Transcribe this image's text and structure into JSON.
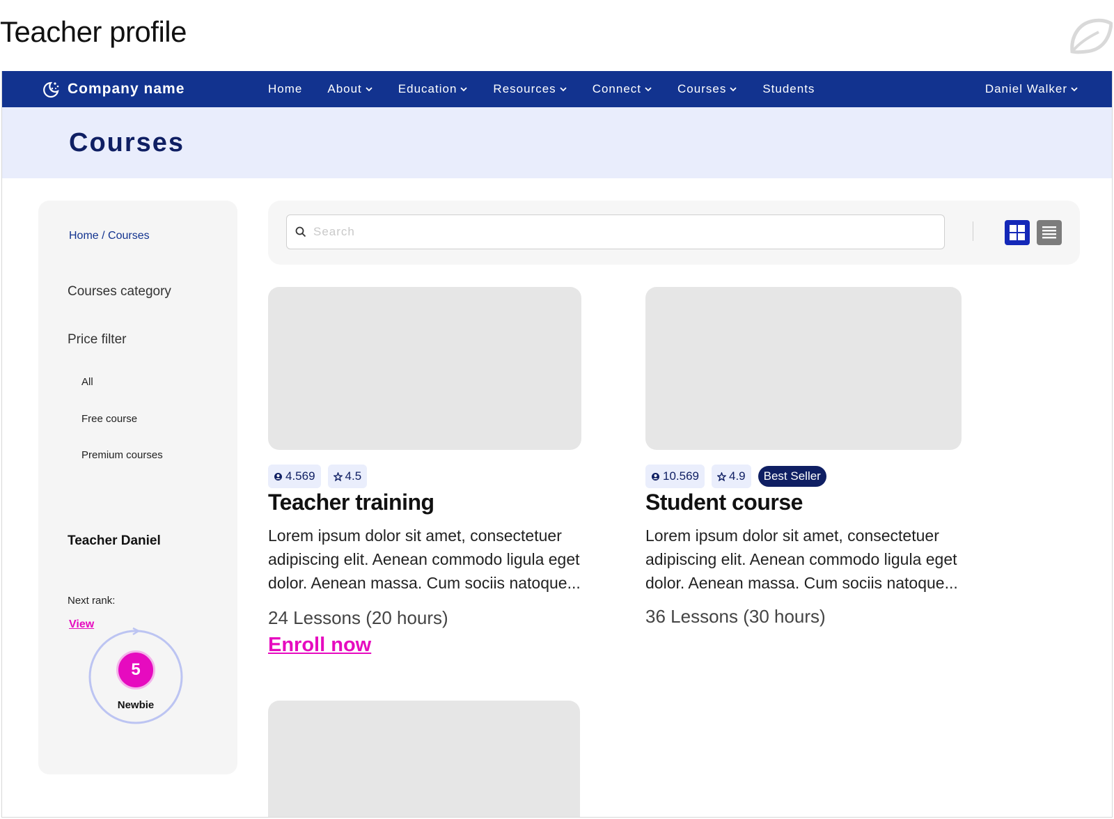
{
  "page": {
    "heading": "Teacher profile"
  },
  "colors": {
    "nav_bg": "#12338f",
    "banner_bg": "#e9edfc",
    "accent": "#e60bbf",
    "title_navy": "#0f1f63"
  },
  "navbar": {
    "brand": "Company name",
    "items": [
      {
        "label": "Home",
        "dropdown": false
      },
      {
        "label": "About",
        "dropdown": true
      },
      {
        "label": "Education",
        "dropdown": true
      },
      {
        "label": "Resources",
        "dropdown": true
      },
      {
        "label": "Connect",
        "dropdown": true
      },
      {
        "label": "Courses",
        "dropdown": true
      },
      {
        "label": "Students",
        "dropdown": false
      }
    ],
    "user": "Daniel Walker"
  },
  "banner": {
    "title": "Courses"
  },
  "sidebar": {
    "breadcrumb": "Home / Courses",
    "category_label": "Courses category",
    "price_filter_label": "Price filter",
    "price_options": [
      "All",
      "Free course",
      "Premium courses"
    ],
    "teacher_name": "Teacher Daniel",
    "next_rank_label": "Next rank:",
    "view_link": "View",
    "rank_number": "5",
    "rank_name": "Newbie"
  },
  "toolbar": {
    "search_placeholder": "Search",
    "search_value": ""
  },
  "courses": [
    {
      "students": "4.569",
      "rating": "4.5",
      "badge": "",
      "title": "Teacher training",
      "description": "Lorem ipsum dolor sit amet, consectetuer adipiscing elit. Aenean commodo ligula eget dolor. Aenean massa. Cum sociis natoque...",
      "lessons": "24 Lessons (20 hours)",
      "cta": "Enroll now"
    },
    {
      "students": "10.569",
      "rating": "4.9",
      "badge": "Best Seller",
      "title": "Student course",
      "description": "Lorem ipsum dolor sit amet, consectetuer adipiscing elit. Aenean commodo ligula eget dolor. Aenean massa. Cum sociis natoque...",
      "lessons": "36 Lessons (30 hours)",
      "cta": ""
    }
  ]
}
